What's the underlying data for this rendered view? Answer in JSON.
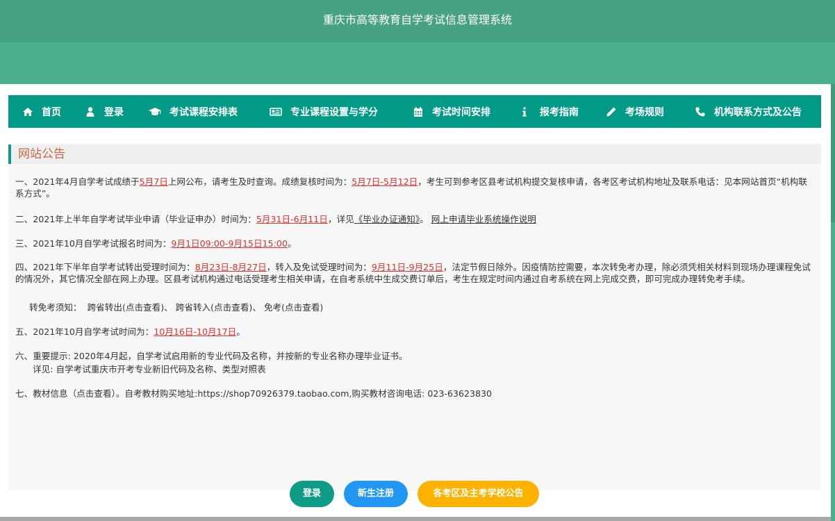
{
  "header": {
    "title": "重庆市高等教育自学考试信息管理系统"
  },
  "nav": {
    "items": [
      {
        "label": "首页",
        "icon": "home-icon"
      },
      {
        "label": "登录",
        "icon": "user-icon"
      },
      {
        "label": "考试课程安排表",
        "icon": "graduation-cap-icon"
      },
      {
        "label": "专业课程设置与学分",
        "icon": "newspaper-icon"
      },
      {
        "label": "考试时间安排",
        "icon": "calendar-icon"
      },
      {
        "label": "报考指南",
        "icon": "info-icon"
      },
      {
        "label": "考场规则",
        "icon": "pencil-icon"
      },
      {
        "label": "机构联系方式及公告",
        "icon": "phone-icon"
      }
    ]
  },
  "notice": {
    "title": "网站公告",
    "n1": {
      "a": "一、2021年4月自学考试成绩于",
      "b": "5月7日",
      "c": "上网公布，请考生及时查询。成绩复核时间为：",
      "d": "5月7日-5月12日",
      "e": "，考生可到参考区县考试机构提交复核申请，各考区考试机构地址及联系电话：见本网站首页“机构联系方式”。"
    },
    "n2": {
      "a": "二、2021年上半年自学考试毕业申请（毕业证申办）时间为：",
      "b": "5月31日-6月11日",
      "c": "，详见",
      "d": "《毕业办证通知》",
      "e": "。 ",
      "f": "网上申请毕业系统操作说明"
    },
    "n3": {
      "a": "三、2021年10月自学考试报名时间为：",
      "b": "9月1日09:00-9月15日15:00",
      "c": "。"
    },
    "n4": {
      "a": "四、2021年下半年自学考试转出受理时间为：",
      "b": "8月23日-8月27日",
      "c": "，转入及免试受理时间为：",
      "d": "9月11日-9月25日",
      "e": "，法定节假日除外。因疫情防控需要，本次转免考办理，除必须凭相关材料到现场办理课程免试的情况外，其它情况全部在网上办理。区县考试机构通过电话受理考生相关申请，在自考系统中生成交费订单后，考生在规定时间内通过自考系统在网上完成交费，即可完成办理转免考手续。",
      "sub_label": "转免考须知：",
      "link1": "跨省转出(点击查看)",
      "sep1": "、",
      "link2": "跨省转入(点击查看)",
      "sep2": "、",
      "link3": "免考(点击查看)"
    },
    "n5": {
      "a": "五、2021年10月自学考试时间为：",
      "b": "10月16日-10月17日",
      "c": "。"
    },
    "n6": {
      "a": "六、重要提示: 2020年4月起，自学考试启用新的专业代码及名称，并按新的专业名称办理毕业证书。",
      "sub_label": "详见:",
      "link": "自学考试重庆市开考专业新旧代码及名称、类型对照表"
    },
    "n7": {
      "link": "七、教材信息（点击查看）",
      "text": "。自考教材购买地址:https://shop70926379.taobao.com,购买教材咨询电话:  023-63623830"
    }
  },
  "buttons": {
    "login": "登录",
    "register": "新生注册",
    "announce": "各考区及主考学校公告"
  },
  "colors": {
    "header": "#47a281",
    "nav": "#009a86",
    "highlight": "#e0302d",
    "btn_login": "#0f9b85",
    "btn_register": "#2196f3",
    "btn_announce": "#ffb300"
  }
}
